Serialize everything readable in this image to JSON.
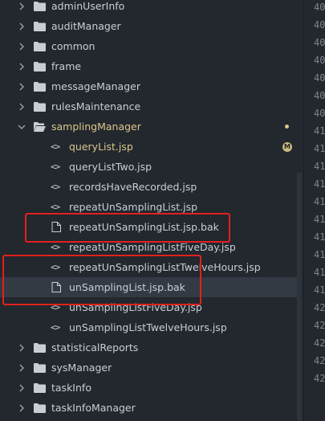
{
  "explorer": {
    "items": [
      {
        "label": "adminUserInfo",
        "type": "folder"
      },
      {
        "label": "auditManager",
        "type": "folder"
      },
      {
        "label": "common",
        "type": "folder"
      },
      {
        "label": "frame",
        "type": "folder"
      },
      {
        "label": "messageManager",
        "type": "folder"
      },
      {
        "label": "rulesMaintenance",
        "type": "folder"
      },
      {
        "label": "samplingManager",
        "type": "folder-open"
      },
      {
        "label": "queryList.jsp",
        "type": "code",
        "status": "M"
      },
      {
        "label": "queryListTwo.jsp",
        "type": "code"
      },
      {
        "label": "recordsHaveRecorded.jsp",
        "type": "code"
      },
      {
        "label": "repeatUnSamplingList.jsp",
        "type": "code"
      },
      {
        "label": "repeatUnSamplingList.jsp.bak",
        "type": "file"
      },
      {
        "label": "repeatUnSamplingListFiveDay.jsp",
        "type": "code"
      },
      {
        "label": "repeatUnSamplingListTwelveHours.jsp",
        "type": "code"
      },
      {
        "label": "unSamplingList.jsp.bak",
        "type": "file",
        "selected": true
      },
      {
        "label": "unSamplingListFiveDay.jsp",
        "type": "code"
      },
      {
        "label": "unSamplingListTwelveHours.jsp",
        "type": "code"
      },
      {
        "label": "statisticalReports",
        "type": "folder"
      },
      {
        "label": "sysManager",
        "type": "folder"
      },
      {
        "label": "taskInfo",
        "type": "folder"
      },
      {
        "label": "taskInfoManager",
        "type": "folder"
      }
    ]
  },
  "gutter": {
    "line_numbers": [
      "40",
      "40",
      "40",
      "40",
      "40",
      "40",
      "40",
      "41",
      "41",
      "41",
      "41",
      "41",
      "41",
      "41",
      "41",
      "41",
      "41",
      "42",
      "42",
      "42",
      "42",
      "42"
    ]
  },
  "colors": {
    "background": "#23272e",
    "modified": "#d9c78a",
    "highlight_box": "#e0211d",
    "selected_row": "#343a44"
  }
}
